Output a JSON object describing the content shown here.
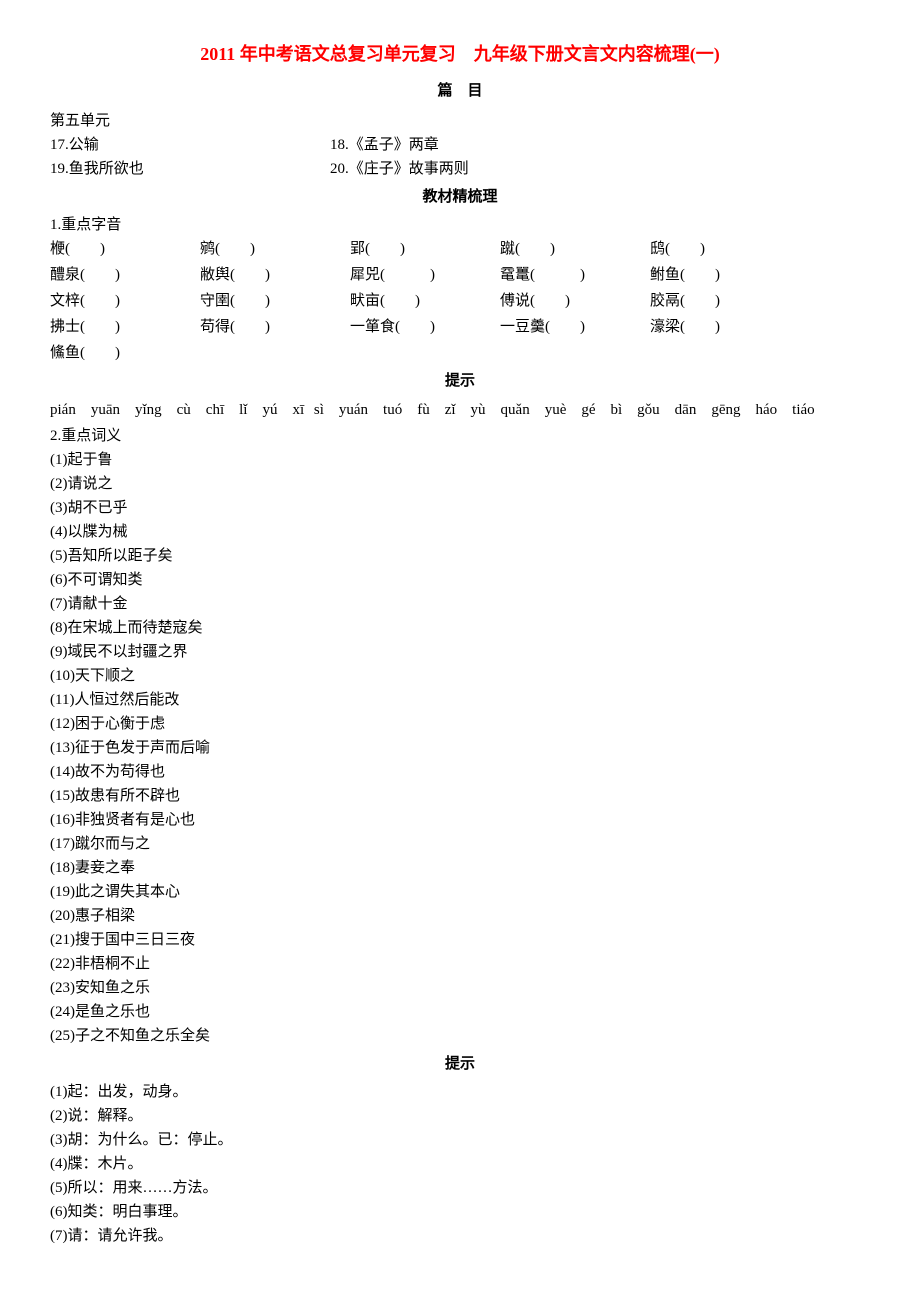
{
  "title": "2011 年中考语文总复习单元复习　九年级下册文言文内容梳理(一)",
  "subtitle_catalog": "篇　目",
  "unit_header": "第五单元",
  "toc": {
    "r1c1": "17.公输",
    "r1c2": "18.《孟子》两章",
    "r2c1": "19.鱼我所欲也",
    "r2c2": "20.《庄子》故事两则"
  },
  "section_refine": "教材精梳理",
  "sec1_label": "1.重点字音",
  "phonetics": [
    [
      "楩(　　)",
      "鹓(　　)",
      "郢(　　)",
      "蹴(　　)",
      "鸱(　　)"
    ],
    [
      "醴泉(　　)",
      "敝舆(　　)",
      "犀兕(　　　)",
      "鼋鼍(　　　)",
      "鲋鱼(　　)"
    ],
    [
      "文梓(　　)",
      "守圉(　　)",
      "畎亩(　　)",
      "傅说(　　)",
      "胶鬲(　　)"
    ],
    [
      "拂士(　　)",
      "苟得(　　)",
      "一箪食(　　)",
      "一豆羹(　　)",
      "濠梁(　　)"
    ],
    [
      "鯈鱼(　　)",
      "",
      "",
      "",
      ""
    ]
  ],
  "hint_label_1": "提示",
  "pinyin_text": "pián　yuān　yǐng　cù　chī　lǐ　yú　xī sì　yuán　tuó　fù　zǐ　yù　quǎn　yuè　gé　bì　gǒu　dān　gēng　háo　tiáo",
  "sec2_label": "2.重点词义",
  "items2": [
    "(1)起于鲁",
    "(2)请说之",
    "(3)胡不已乎",
    "(4)以牒为械",
    "(5)吾知所以距子矣",
    "(6)不可谓知类",
    "(7)请献十金",
    "(8)在宋城上而待楚寇矣",
    "(9)域民不以封疆之界",
    "(10)天下顺之",
    "(11)人恒过然后能改",
    "(12)困于心衡于虑",
    "(13)征于色发于声而后喻",
    "(14)故不为苟得也",
    "(15)故患有所不辟也",
    "(16)非独贤者有是心也",
    "(17)蹴尔而与之",
    "(18)妻妾之奉",
    "(19)此之谓失其本心",
    "(20)惠子相梁",
    "(21)搜于国中三日三夜",
    "(22)非梧桐不止",
    "(23)安知鱼之乐",
    "(24)是鱼之乐也",
    "(25)子之不知鱼之乐全矣"
  ],
  "hint_label_2": "提示",
  "answers": [
    "(1)起：出发，动身。",
    "(2)说：解释。",
    "(3)胡：为什么。已：停止。",
    "(4)牒：木片。",
    "(5)所以：用来……方法。",
    "(6)知类：明白事理。",
    "(7)请：请允许我。"
  ]
}
